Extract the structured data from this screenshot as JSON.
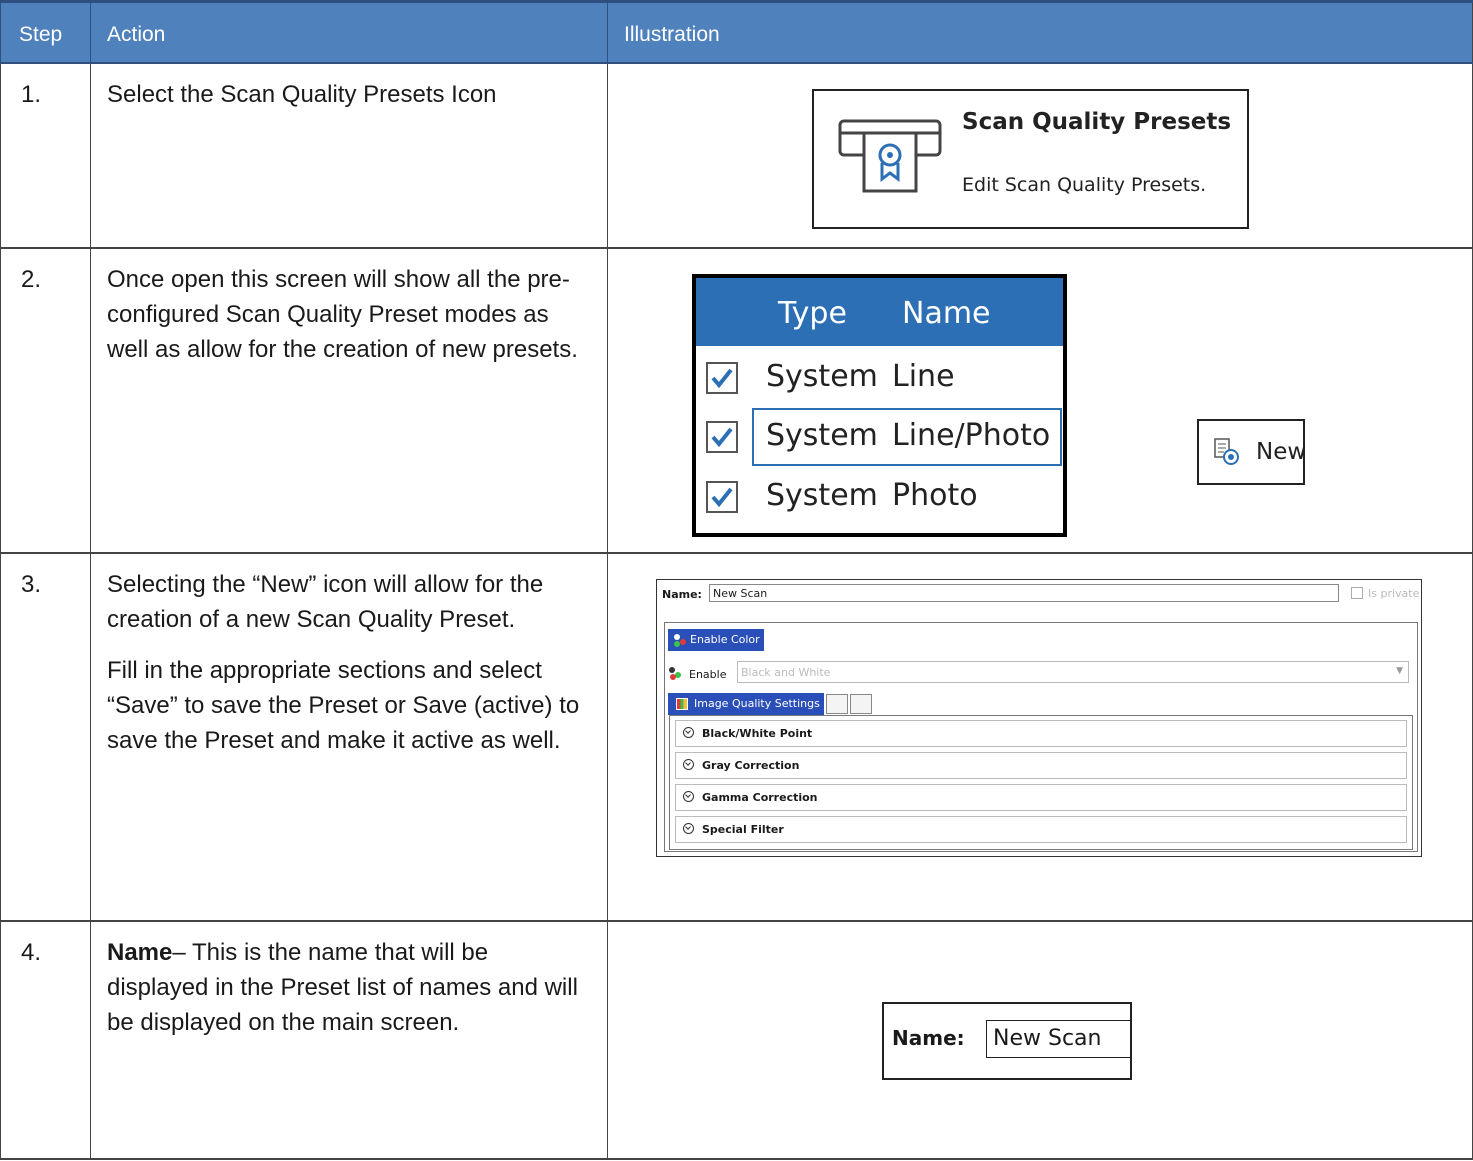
{
  "header": {
    "step": "Step",
    "action": "Action",
    "illustration": "Illustration"
  },
  "rows": [
    {
      "step": "1.",
      "action": "Select the Scan Quality Presets Icon"
    },
    {
      "step": "2.",
      "action": "Once open this screen will show all the pre-configured Scan Quality Preset modes as well as allow for the creation of new presets."
    },
    {
      "step": "3.",
      "action": "Selecting the “New” icon will allow for the creation of a new Scan Quality Preset.",
      "action2": "Fill in the appropriate sections and select “Save” to save the Preset or Save (active) to save the Preset and make it active as well."
    },
    {
      "step": "4.",
      "action_bold": "Name",
      "action": "– This is the name that will be displayed in the Preset list of names and will be displayed on the main screen."
    }
  ],
  "ill1": {
    "title": "Scan Quality Presets",
    "subtitle": "Edit Scan Quality Presets.",
    "icon": "scanner-ribbon-icon"
  },
  "ill2": {
    "col_type": "Type",
    "col_name": "Name",
    "rows": [
      {
        "type": "System",
        "name": "Line"
      },
      {
        "type": "System",
        "name": "Line/Photo"
      },
      {
        "type": "System",
        "name": "Photo"
      }
    ],
    "new_label": "New",
    "accent": "#2c6fb5"
  },
  "ill3": {
    "name_label": "Name:",
    "name_value": "New Scan",
    "private_label": "Is private",
    "enable_color": "Enable Color",
    "enable_label": "Enable",
    "enable_value": "Black and White",
    "tab_label": "Image Quality Settings",
    "sections": [
      "Black/White Point",
      "Gray Correction",
      "Gamma Correction",
      "Special Filter"
    ],
    "accent": "#2a4fb8"
  },
  "ill4": {
    "name_label": "Name:",
    "name_value": "New Scan"
  },
  "colors": {
    "header_bg": "#4f81bd"
  }
}
